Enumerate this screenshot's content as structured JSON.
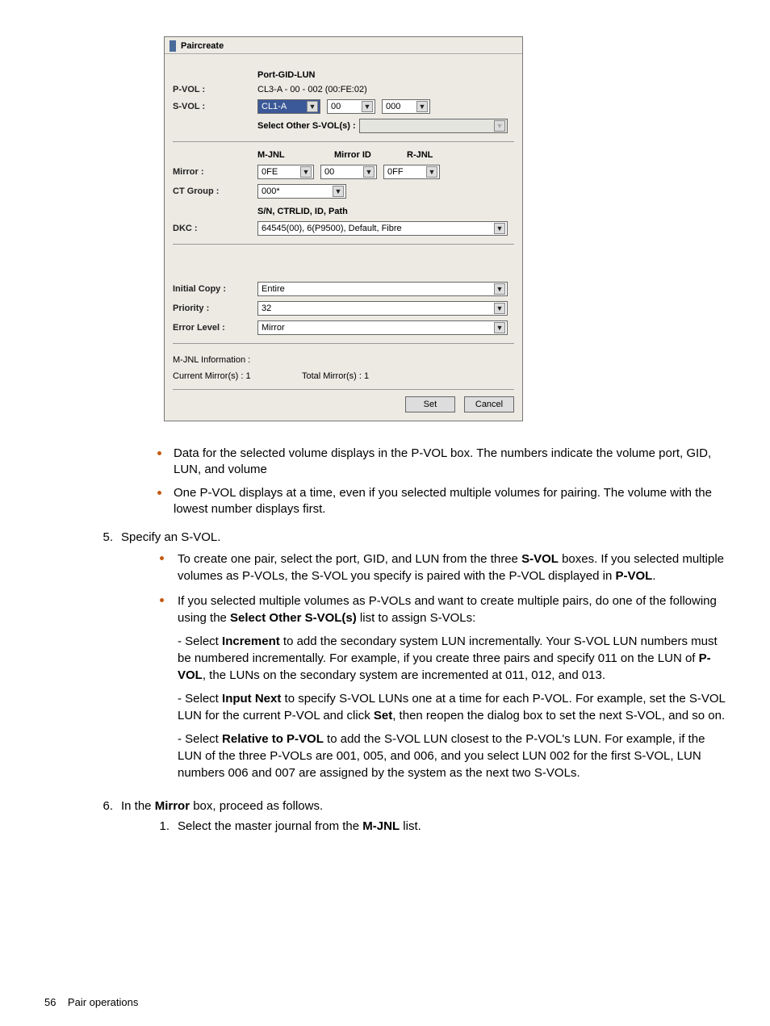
{
  "dialog": {
    "title": "Paircreate",
    "port_header": "Port-GID-LUN",
    "pvol_label": "P-VOL :",
    "pvol_value": "CL3-A - 00 - 002 (00:FE:02)",
    "svol_label": "S-VOL :",
    "svol_port": "CL1-A",
    "svol_gid": "00",
    "svol_lun": "000",
    "select_other_label": "Select Other S-VOL(s) :",
    "mjnl_header": "M-JNL",
    "mirrorid_header": "Mirror ID",
    "rjnl_header": "R-JNL",
    "mirror_label": "Mirror :",
    "mirror_mjnl": "0FE",
    "mirror_id": "00",
    "mirror_rjnl": "0FF",
    "ctgroup_label": "CT Group :",
    "ctgroup_value": "000*",
    "sn_header": "S/N, CTRLID, ID, Path",
    "dkc_label": "DKC :",
    "dkc_value": "64545(00), 6(P9500), Default, Fibre",
    "initialcopy_label": "Initial Copy :",
    "initialcopy_value": "Entire",
    "priority_label": "Priority :",
    "priority_value": "32",
    "errorlevel_label": "Error Level :",
    "errorlevel_value": "Mirror",
    "mjnl_info_label": "M-JNL Information :",
    "current_mirrors_label": "Current Mirror(s) :  1",
    "total_mirrors_label": "Total Mirror(s) :  1",
    "set_btn": "Set",
    "cancel_btn": "Cancel"
  },
  "bullets_top": {
    "b1": "Data for the selected volume displays in the P-VOL box. The numbers indicate the volume port, GID, LUN, and volume",
    "b2": "One P-VOL displays at a time, even if you selected multiple volumes for pairing. The volume with the lowest number displays first."
  },
  "step5": {
    "num": "5.",
    "text": "Specify an S-VOL.",
    "sb1_a": "To create one pair, select the port, GID, and LUN from the three ",
    "sb1_bold1": "S-VOL",
    "sb1_b": " boxes. If you selected multiple volumes as P-VOLs, the S-VOL you specify is paired with the P-VOL displayed in ",
    "sb1_bold2": "P-VOL",
    "sb1_c": ".",
    "sb2_a": "If you selected multiple volumes as P-VOLs and want to create multiple pairs, do one of the following using the ",
    "sb2_bold1": "Select Other S-VOL(s)",
    "sb2_b": " list to assign S-VOLs:",
    "p1_a": "- Select ",
    "p1_bold": "Increment",
    "p1_b": " to add the secondary system LUN incrementally. Your S-VOL LUN numbers must be numbered incrementally. For example, if you create three pairs and specify 011 on the LUN of ",
    "p1_bold2": "P-VOL",
    "p1_c": ", the LUNs on the secondary system are incremented at 011, 012, and 013.",
    "p2_a": "- Select ",
    "p2_bold": "Input Next",
    "p2_b": " to specify S-VOL LUNs one at a time for each P-VOL. For example, set the S-VOL LUN for the current P-VOL and click ",
    "p2_bold2": "Set",
    "p2_c": ", then reopen the dialog box to set the next S-VOL, and so on.",
    "p3_a": "- Select ",
    "p3_bold": "Relative to P-VOL",
    "p3_b": " to add the S-VOL LUN closest to the P-VOL's LUN. For example, if the LUN of the three P-VOLs are 001, 005, and 006, and you select LUN 002 for the first S-VOL, LUN numbers 006 and 007 are assigned by the system as the next two S-VOLs."
  },
  "step6": {
    "num": "6.",
    "text_a": "In the ",
    "text_bold": "Mirror",
    "text_b": " box, proceed as follows.",
    "inner1_num": "1.",
    "inner1_a": "Select the master journal from the ",
    "inner1_bold": "M-JNL",
    "inner1_b": " list."
  },
  "footer": {
    "page": "56",
    "title": "Pair operations"
  }
}
